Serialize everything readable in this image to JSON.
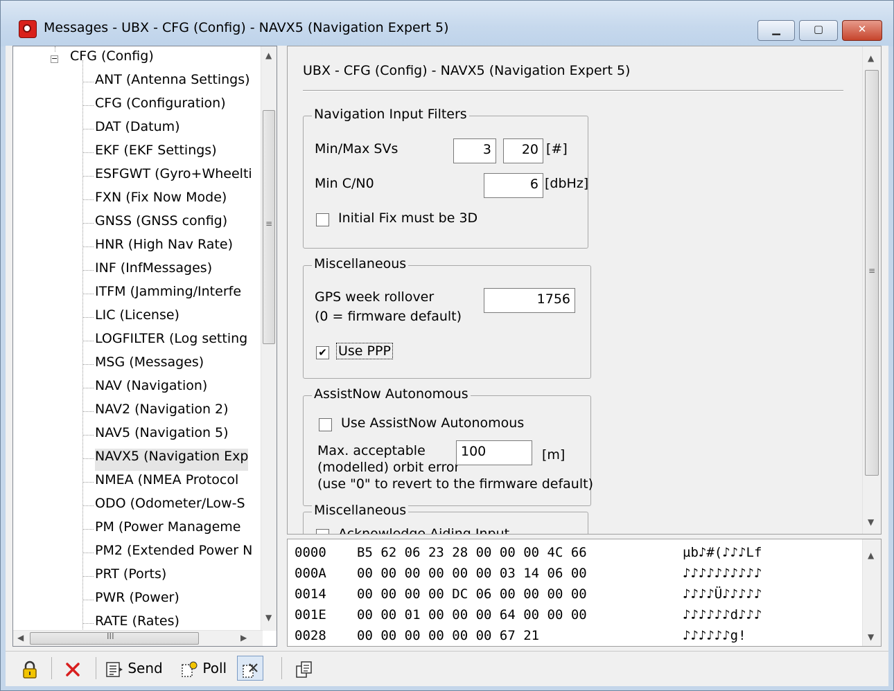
{
  "window": {
    "title": "Messages - UBX - CFG (Config) - NAVX5 (Navigation Expert 5)",
    "minimize": "▁",
    "maximize": "▢",
    "close": "✕"
  },
  "tree": {
    "root": "CFG (Config)",
    "items": [
      "ANT (Antenna Settings)",
      "CFG (Configuration)",
      "DAT (Datum)",
      "EKF (EKF Settings)",
      "ESFGWT (Gyro+Wheelti",
      "FXN (Fix Now Mode)",
      "GNSS (GNSS config)",
      "HNR (High Nav Rate)",
      "INF (InfMessages)",
      "ITFM (Jamming/Interfe",
      "LIC (License)",
      "LOGFILTER (Log setting",
      "MSG (Messages)",
      "NAV (Navigation)",
      "NAV2 (Navigation 2)",
      "NAV5 (Navigation 5)",
      "NAVX5 (Navigation Exp",
      "NMEA (NMEA Protocol",
      "ODO (Odometer/Low-S",
      "PM (Power Manageme",
      "PM2 (Extended Power N",
      "PRT (Ports)",
      "PWR (Power)",
      "RATE (Rates)"
    ],
    "selected": "NAVX5 (Navigation Exp",
    "hscroll_grip": "III"
  },
  "pane": {
    "title": "UBX - CFG (Config) - NAVX5 (Navigation Expert 5)",
    "nav_filters": {
      "title": "Navigation Input Filters",
      "min_max_svs_label": "Min/Max SVs",
      "min_svs": "3",
      "max_svs": "20",
      "svs_unit": "[#]",
      "min_cno_label": "Min C/N0",
      "min_cno": "6",
      "cno_unit": "[dbHz]",
      "fix3d_label": "Initial Fix must be 3D",
      "fix3d_checked": false
    },
    "misc1": {
      "title": "Miscellaneous",
      "rollover_label": "GPS week rollover",
      "rollover_note": "(0 = firmware default)",
      "rollover_value": "1756",
      "ppp_label": "Use PPP",
      "ppp_checked": true
    },
    "assistnow": {
      "title": "AssistNow Autonomous",
      "use_label": "Use AssistNow Autonomous",
      "use_checked": false,
      "orbit_label1": "Max. acceptable",
      "orbit_label2": "(modelled) orbit error",
      "orbit_value": "100",
      "orbit_unit": "[m]",
      "orbit_note": "(use \"0\" to revert to the firmware default)"
    },
    "misc2": {
      "title": "Miscellaneous",
      "ack_label": "Acknowledge Aiding Input"
    }
  },
  "hex": [
    {
      "offset": "0000",
      "bytes": "B5 62 06 23 28 00 00 00 4C 66",
      "ascii": "µb♪#(♪♪♪Lf"
    },
    {
      "offset": "000A",
      "bytes": "00 00 00 00 00 00 03 14 06 00",
      "ascii": "♪♪♪♪♪♪♪♪♪♪"
    },
    {
      "offset": "0014",
      "bytes": "00 00 00 00 DC 06 00 00 00 00",
      "ascii": "♪♪♪♪Ü♪♪♪♪♪"
    },
    {
      "offset": "001E",
      "bytes": "00 00 01 00 00 00 64 00 00 00",
      "ascii": "♪♪♪♪♪♪d♪♪♪"
    },
    {
      "offset": "0028",
      "bytes": "00 00 00 00 00 00 67 21",
      "ascii": "♪♪♪♪♪♪g!"
    }
  ],
  "toolbar": {
    "send": "Send",
    "poll": "Poll"
  },
  "colors": {
    "accent": "#c4d6ea",
    "close": "#c6442c",
    "lock": "#f2c400",
    "delete": "#d81e1e"
  }
}
